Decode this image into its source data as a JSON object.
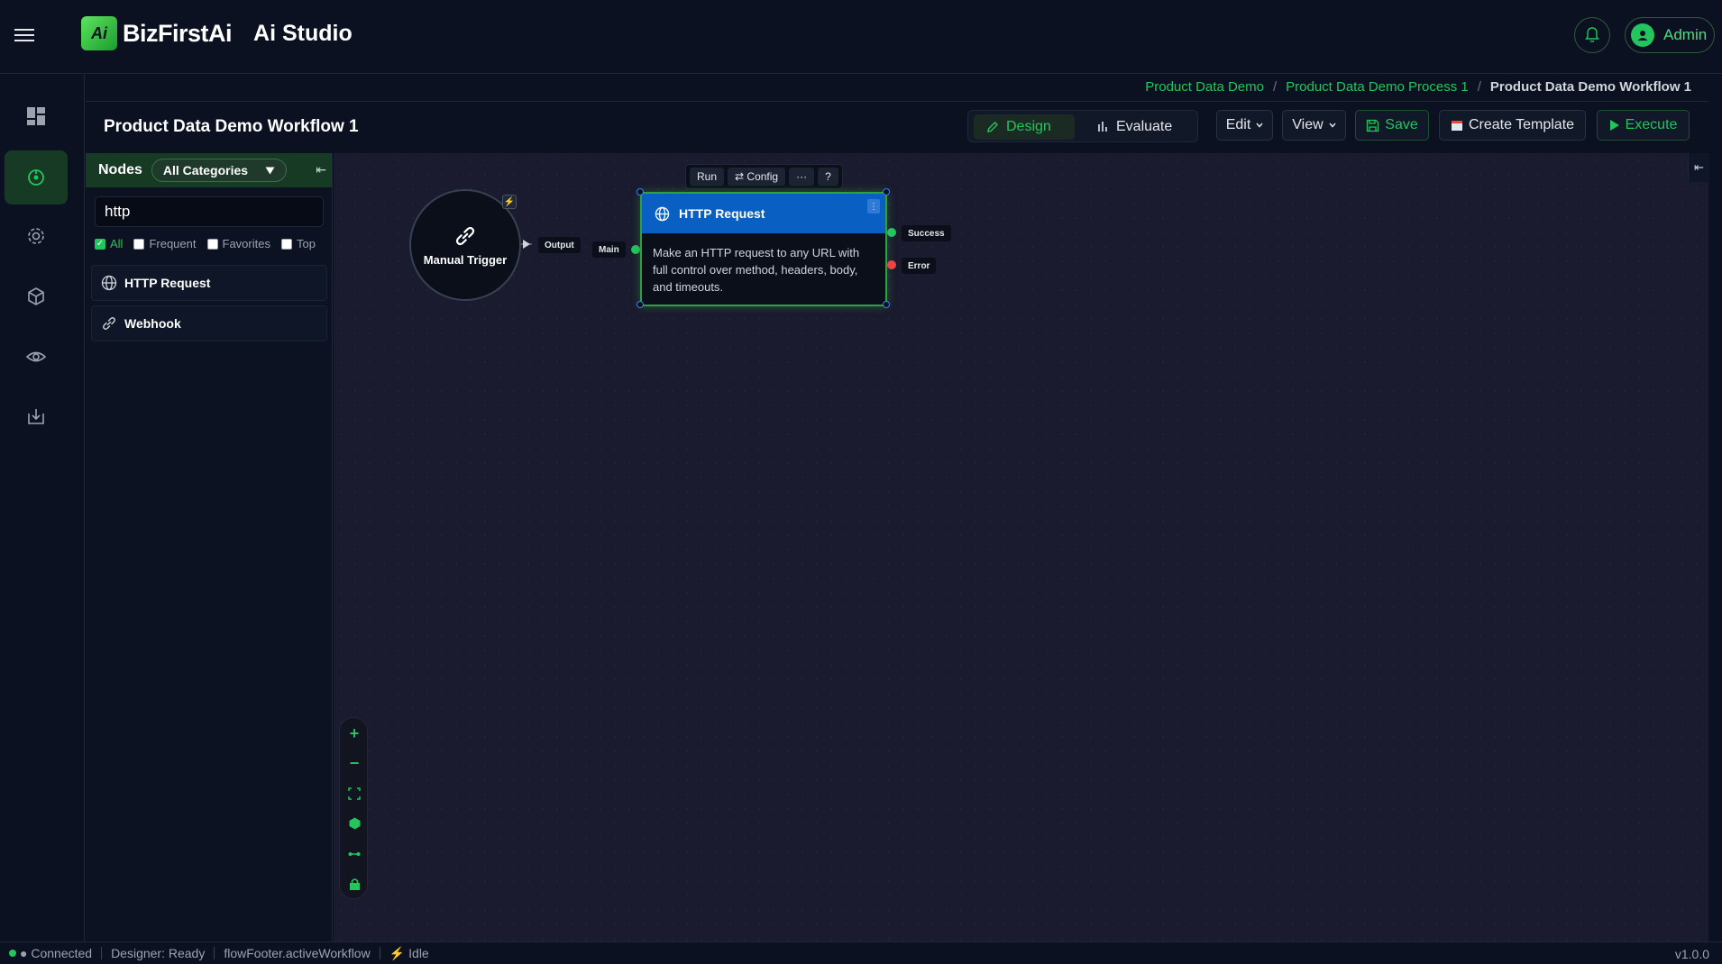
{
  "app": {
    "brand": "BizFirstAi",
    "brand_mark": "Ai",
    "product": "Ai Studio"
  },
  "header": {
    "bell_icon": "bell-icon",
    "user_label": "Admin",
    "user_icon": "user-circle-icon"
  },
  "rail": {
    "items": [
      {
        "icon": "dashboard-grid-icon"
      },
      {
        "icon": "workflow-icon",
        "active": true
      },
      {
        "icon": "gear-icon"
      },
      {
        "icon": "cube-icon"
      },
      {
        "icon": "eye-icon"
      },
      {
        "icon": "download-tray-icon"
      }
    ]
  },
  "breadcrumb": {
    "items": [
      "Product Data Demo",
      "Product Data Demo Process 1",
      "Product Data Demo Workflow 1"
    ],
    "separator": "/"
  },
  "page": {
    "title": "Product Data Demo Workflow 1"
  },
  "toolbar": {
    "design_label": "Design",
    "evaluate_label": "Evaluate",
    "edit_label": "Edit",
    "view_label": "View",
    "save_label": "Save",
    "create_template_label": "Create Template",
    "execute_label": "Execute"
  },
  "nodes_panel": {
    "title": "Nodes",
    "category": "All Categories",
    "search_value": "http",
    "filters": [
      {
        "label": "All",
        "checked": true
      },
      {
        "label": "Frequent",
        "checked": false
      },
      {
        "label": "Favorites",
        "checked": false
      },
      {
        "label": "Top",
        "checked": false
      }
    ],
    "items": [
      {
        "label": "HTTP Request",
        "icon": "globe-icon"
      },
      {
        "label": "Webhook",
        "icon": "link-icon"
      }
    ]
  },
  "canvas": {
    "trigger": {
      "label": "Manual Trigger",
      "icon": "link-icon",
      "output_label": "Output"
    },
    "node_toolbar": {
      "run": "Run",
      "config": "Config",
      "more": "···",
      "help": "?"
    },
    "http_node": {
      "title": "HTTP Request",
      "input_label": "Main",
      "description": "Make an HTTP request to any URL with full control over method, headers, body, and timeouts.",
      "outputs": [
        {
          "label": "Success",
          "color": "#22c55e"
        },
        {
          "label": "Error",
          "color": "#ef4444"
        }
      ]
    },
    "zoom_controls": [
      "zoom-in-icon",
      "zoom-out-icon",
      "fit-view-icon",
      "hexagon-icon",
      "connect-icon",
      "lock-icon"
    ]
  },
  "footer": {
    "connection": "● Connected",
    "designer": "Designer: Ready",
    "workflow_key": "flowFooter.activeWorkflow",
    "state": "Idle",
    "version": "v1.0.0"
  },
  "colors": {
    "accent": "#22c55e",
    "node_header": "#0a5fc2",
    "canvas_bg": "#1a1b2e"
  }
}
